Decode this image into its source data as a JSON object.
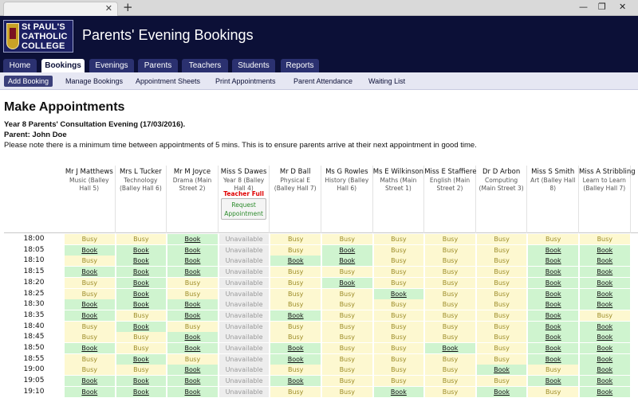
{
  "browser": {
    "new_tab_glyph": "+",
    "close_glyph": "✕"
  },
  "school": {
    "logo_line1": "St PAUL'S",
    "logo_line2": "CATHOLIC",
    "logo_line3": "COLLEGE"
  },
  "site_title": "Parents' Evening Bookings",
  "main_nav": [
    {
      "label": "Home",
      "active": false
    },
    {
      "label": "Bookings",
      "active": true
    },
    {
      "label": "Evenings",
      "active": false
    },
    {
      "label": "Parents",
      "active": false
    },
    {
      "label": "Teachers",
      "active": false
    },
    {
      "label": "Students",
      "active": false
    },
    {
      "label": "Reports",
      "active": false
    }
  ],
  "sub_nav": [
    {
      "label": "Add Booking",
      "active": true
    },
    {
      "label": "Manage Bookings",
      "active": false
    },
    {
      "label": "Appointment Sheets",
      "active": false
    },
    {
      "label": "Print Appointments",
      "active": false
    },
    {
      "label": "Parent Attendance",
      "active": false
    },
    {
      "label": "Waiting List",
      "active": false
    }
  ],
  "page": {
    "title": "Make Appointments",
    "evening": "Year 8 Parents' Consultation Evening (17/03/2016).",
    "parent": "Parent: John Doe",
    "note": "Please note there is a minimum time between appointments of 5 mins. This is to ensure parents arrive at their next appointment in good time."
  },
  "teachers": [
    {
      "name": "Mr J Matthews",
      "subject": "Music (Balley Hall 5)"
    },
    {
      "name": "Mrs L Tucker",
      "subject": "Technology (Balley Hall 6)"
    },
    {
      "name": "Mr M Joyce",
      "subject": "Drama (Main Street 2)"
    },
    {
      "name": "Miss S Dawes",
      "subject": "Year 8 (Balley Hall 4)",
      "full_label": "Teacher Full",
      "request_label": "Request Appointment"
    },
    {
      "name": "Mr D Ball",
      "subject": "Physical E (Balley Hall 7)"
    },
    {
      "name": "Ms G Rowles",
      "subject": "History (Balley Hall 6)"
    },
    {
      "name": "Ms E Wilkinson",
      "subject": "Maths (Main Street 1)"
    },
    {
      "name": "Miss E Staffiere",
      "subject": "English (Main Street 2)"
    },
    {
      "name": "Dr D Arbon",
      "subject": "Computing (Main Street 3)"
    },
    {
      "name": "Miss S Smith",
      "subject": "Art (Balley Hall 8)"
    },
    {
      "name": "Miss A Stribbling",
      "subject": "Learn to Learn (Balley Hall 7)"
    }
  ],
  "labels": {
    "busy": "Busy",
    "book": "Book",
    "unavailable": "Unavailable"
  },
  "slots": [
    {
      "time": "18:00",
      "cells": [
        "busy",
        "busy",
        "book",
        "unav",
        "busy",
        "busy",
        "busy",
        "busy",
        "busy",
        "busy",
        "busy"
      ]
    },
    {
      "time": "18:05",
      "cells": [
        "book",
        "book",
        "book",
        "unav",
        "busy",
        "book",
        "busy",
        "busy",
        "busy",
        "book",
        "book"
      ]
    },
    {
      "time": "18:10",
      "cells": [
        "busy",
        "book",
        "book",
        "unav",
        "book",
        "book",
        "busy",
        "busy",
        "busy",
        "book",
        "book"
      ]
    },
    {
      "time": "18:15",
      "cells": [
        "book",
        "book",
        "book",
        "unav",
        "busy",
        "busy",
        "busy",
        "busy",
        "busy",
        "book",
        "book"
      ]
    },
    {
      "time": "18:20",
      "cells": [
        "busy",
        "book",
        "busy",
        "unav",
        "busy",
        "book",
        "busy",
        "busy",
        "busy",
        "book",
        "book"
      ]
    },
    {
      "time": "18:25",
      "cells": [
        "busy",
        "book",
        "busy",
        "unav",
        "busy",
        "busy",
        "book",
        "busy",
        "busy",
        "book",
        "book"
      ]
    },
    {
      "time": "18:30",
      "cells": [
        "book",
        "book",
        "book",
        "unav",
        "busy",
        "busy",
        "busy",
        "busy",
        "busy",
        "book",
        "book"
      ]
    },
    {
      "time": "18:35",
      "cells": [
        "book",
        "busy",
        "book",
        "unav",
        "book",
        "busy",
        "busy",
        "busy",
        "busy",
        "book",
        "busy"
      ]
    },
    {
      "time": "18:40",
      "cells": [
        "busy",
        "book",
        "busy",
        "unav",
        "busy",
        "busy",
        "busy",
        "busy",
        "busy",
        "book",
        "book"
      ]
    },
    {
      "time": "18:45",
      "cells": [
        "busy",
        "busy",
        "book",
        "unav",
        "busy",
        "busy",
        "busy",
        "busy",
        "busy",
        "book",
        "book"
      ]
    },
    {
      "time": "18:50",
      "cells": [
        "book",
        "busy",
        "book",
        "unav",
        "book",
        "busy",
        "busy",
        "book",
        "busy",
        "book",
        "book"
      ]
    },
    {
      "time": "18:55",
      "cells": [
        "busy",
        "book",
        "busy",
        "unav",
        "book",
        "busy",
        "busy",
        "busy",
        "busy",
        "book",
        "book"
      ]
    },
    {
      "time": "19:00",
      "cells": [
        "busy",
        "busy",
        "book",
        "unav",
        "busy",
        "busy",
        "busy",
        "busy",
        "book",
        "busy",
        "book"
      ]
    },
    {
      "time": "19:05",
      "cells": [
        "book",
        "book",
        "book",
        "unav",
        "book",
        "busy",
        "busy",
        "busy",
        "busy",
        "book",
        "book"
      ]
    },
    {
      "time": "19:10",
      "cells": [
        "book",
        "book",
        "book",
        "unav",
        "busy",
        "busy",
        "book",
        "busy",
        "book",
        "busy",
        "book"
      ]
    }
  ]
}
